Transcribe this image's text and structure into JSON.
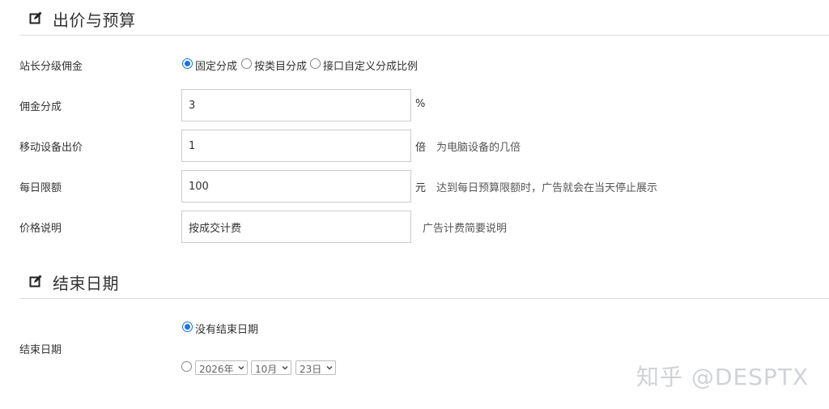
{
  "bid_section": {
    "title": "出价与预算",
    "commission_type": {
      "label": "站长分级佣金",
      "options": [
        "固定分成",
        "按类目分成",
        "接口自定义分成比例"
      ],
      "selected_index": 0
    },
    "commission_rate": {
      "label": "佣金分成",
      "value": "3",
      "unit": "%"
    },
    "mobile_bid": {
      "label": "移动设备出价",
      "value": "1",
      "unit": "倍",
      "hint": "为电脑设备的几倍"
    },
    "daily_limit": {
      "label": "每日限额",
      "value": "100",
      "unit": "元",
      "hint": "达到每日预算限额时，广告就会在当天停止展示"
    },
    "price_note": {
      "label": "价格说明",
      "value": "按成交计费",
      "hint": "广告计费简要说明"
    }
  },
  "end_section": {
    "title": "结束日期",
    "end_date": {
      "label": "结束日期",
      "no_end_label": "没有结束日期",
      "no_end_selected": true,
      "year": "2026年",
      "month": "10月",
      "day": "23日"
    }
  },
  "watermark": "知乎 @DESPTX",
  "colors": {
    "accent": "#1a73e8",
    "border": "#cccccc",
    "divider": "#dddddd"
  }
}
